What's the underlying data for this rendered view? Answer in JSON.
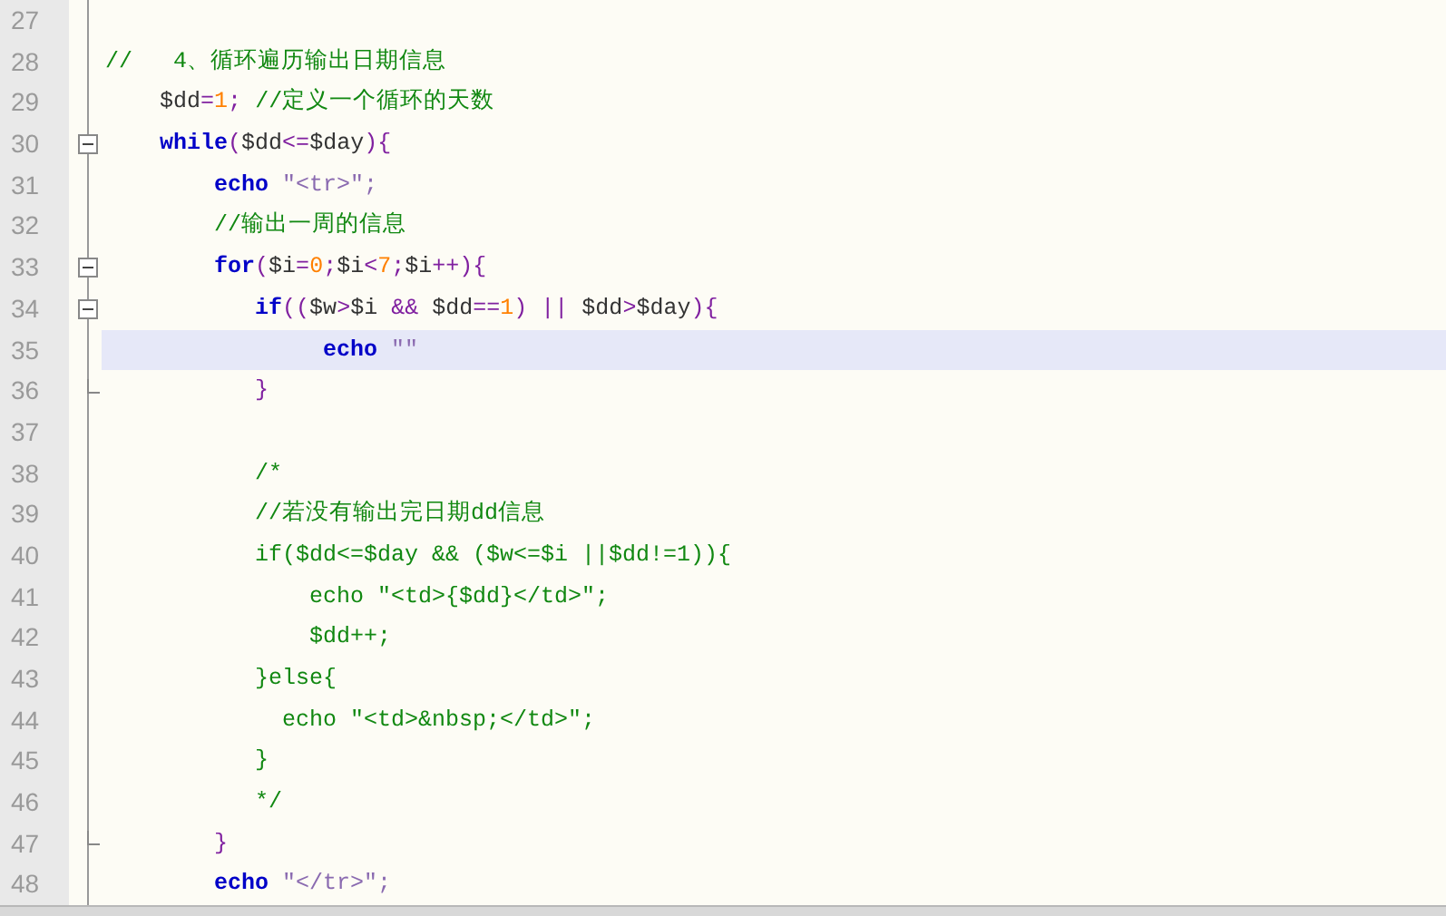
{
  "editor": {
    "lines": [
      {
        "number": "27",
        "foldable": false,
        "block_end": false,
        "highlighted": false
      },
      {
        "number": "28",
        "foldable": false,
        "block_end": false,
        "highlighted": false,
        "tokens": [
          {
            "kind": "comment",
            "text": "//   4、循环遍历输出日期信息"
          }
        ]
      },
      {
        "number": "29",
        "foldable": false,
        "block_end": false,
        "highlighted": false,
        "tokens": [
          {
            "kind": "var",
            "text": "    $dd"
          },
          {
            "kind": "op",
            "text": "="
          },
          {
            "kind": "num",
            "text": "1"
          },
          {
            "kind": "op",
            "text": ";"
          },
          {
            "kind": "comment",
            "text": " //定义一个循环的天数"
          }
        ]
      },
      {
        "number": "30",
        "foldable": true,
        "block_end": false,
        "highlighted": false,
        "tokens": [
          {
            "kind": "keyword",
            "text": "    while"
          },
          {
            "kind": "op",
            "text": "("
          },
          {
            "kind": "var",
            "text": "$dd"
          },
          {
            "kind": "op",
            "text": "<="
          },
          {
            "kind": "var",
            "text": "$day"
          },
          {
            "kind": "op",
            "text": "){"
          }
        ]
      },
      {
        "number": "31",
        "foldable": false,
        "block_end": false,
        "highlighted": false,
        "tokens": [
          {
            "kind": "keyword",
            "text": "        echo"
          },
          {
            "kind": "str",
            "text": " \"<tr>\";"
          }
        ]
      },
      {
        "number": "32",
        "foldable": false,
        "block_end": false,
        "highlighted": false,
        "tokens": [
          {
            "kind": "comment",
            "text": "        //输出一周的信息"
          }
        ]
      },
      {
        "number": "33",
        "foldable": true,
        "block_end": false,
        "highlighted": false,
        "tokens": [
          {
            "kind": "keyword",
            "text": "        for"
          },
          {
            "kind": "op",
            "text": "("
          },
          {
            "kind": "var",
            "text": "$i"
          },
          {
            "kind": "op",
            "text": "="
          },
          {
            "kind": "num",
            "text": "0"
          },
          {
            "kind": "op",
            "text": ";"
          },
          {
            "kind": "var",
            "text": "$i"
          },
          {
            "kind": "op",
            "text": "<"
          },
          {
            "kind": "num",
            "text": "7"
          },
          {
            "kind": "op",
            "text": ";"
          },
          {
            "kind": "var",
            "text": "$i"
          },
          {
            "kind": "op",
            "text": "++){"
          }
        ]
      },
      {
        "number": "34",
        "foldable": true,
        "block_end": false,
        "highlighted": false,
        "tokens": [
          {
            "kind": "keyword",
            "text": "           if"
          },
          {
            "kind": "op",
            "text": "(("
          },
          {
            "kind": "var",
            "text": "$w"
          },
          {
            "kind": "op",
            "text": ">"
          },
          {
            "kind": "var",
            "text": "$i"
          },
          {
            "kind": "op",
            "text": " && "
          },
          {
            "kind": "var",
            "text": "$dd"
          },
          {
            "kind": "op",
            "text": "=="
          },
          {
            "kind": "num",
            "text": "1"
          },
          {
            "kind": "op",
            "text": ") || "
          },
          {
            "kind": "var",
            "text": "$dd"
          },
          {
            "kind": "op",
            "text": ">"
          },
          {
            "kind": "var",
            "text": "$day"
          },
          {
            "kind": "op",
            "text": "){"
          }
        ]
      },
      {
        "number": "35",
        "foldable": false,
        "block_end": false,
        "highlighted": true,
        "tokens": [
          {
            "kind": "keyword",
            "text": "                echo"
          },
          {
            "kind": "str",
            "text": " \"\""
          }
        ]
      },
      {
        "number": "36",
        "foldable": false,
        "block_end": true,
        "highlighted": false,
        "tokens": [
          {
            "kind": "op",
            "text": "           }"
          }
        ]
      },
      {
        "number": "37",
        "foldable": false,
        "block_end": false,
        "highlighted": false
      },
      {
        "number": "38",
        "foldable": false,
        "block_end": false,
        "highlighted": false,
        "tokens": [
          {
            "kind": "comment",
            "text": "           /*"
          }
        ]
      },
      {
        "number": "39",
        "foldable": false,
        "block_end": false,
        "highlighted": false,
        "tokens": [
          {
            "kind": "comment",
            "text": "           //若没有输出完日期dd信息"
          }
        ]
      },
      {
        "number": "40",
        "foldable": false,
        "block_end": false,
        "highlighted": false,
        "tokens": [
          {
            "kind": "comment",
            "text": "           if($dd<=$day && ($w<=$i ||$dd!=1)){"
          }
        ]
      },
      {
        "number": "41",
        "foldable": false,
        "block_end": false,
        "highlighted": false,
        "tokens": [
          {
            "kind": "comment",
            "text": "               echo \"<td>{$dd}</td>\";"
          }
        ]
      },
      {
        "number": "42",
        "foldable": false,
        "block_end": false,
        "highlighted": false,
        "tokens": [
          {
            "kind": "comment",
            "text": "               $dd++;"
          }
        ]
      },
      {
        "number": "43",
        "foldable": false,
        "block_end": false,
        "highlighted": false,
        "tokens": [
          {
            "kind": "comment",
            "text": "           }else{"
          }
        ]
      },
      {
        "number": "44",
        "foldable": false,
        "block_end": false,
        "highlighted": false,
        "tokens": [
          {
            "kind": "comment",
            "text": "             echo \"<td>&nbsp;</td>\";"
          }
        ]
      },
      {
        "number": "45",
        "foldable": false,
        "block_end": false,
        "highlighted": false,
        "tokens": [
          {
            "kind": "comment",
            "text": "           }"
          }
        ]
      },
      {
        "number": "46",
        "foldable": false,
        "block_end": false,
        "highlighted": false,
        "tokens": [
          {
            "kind": "comment",
            "text": "           */"
          }
        ]
      },
      {
        "number": "47",
        "foldable": false,
        "block_end": true,
        "highlighted": false,
        "tokens": [
          {
            "kind": "op",
            "text": "        }"
          }
        ]
      },
      {
        "number": "48",
        "foldable": false,
        "block_end": false,
        "highlighted": false,
        "tokens": [
          {
            "kind": "keyword",
            "text": "        echo"
          },
          {
            "kind": "str",
            "text": " \"</tr>\";"
          }
        ]
      }
    ]
  }
}
